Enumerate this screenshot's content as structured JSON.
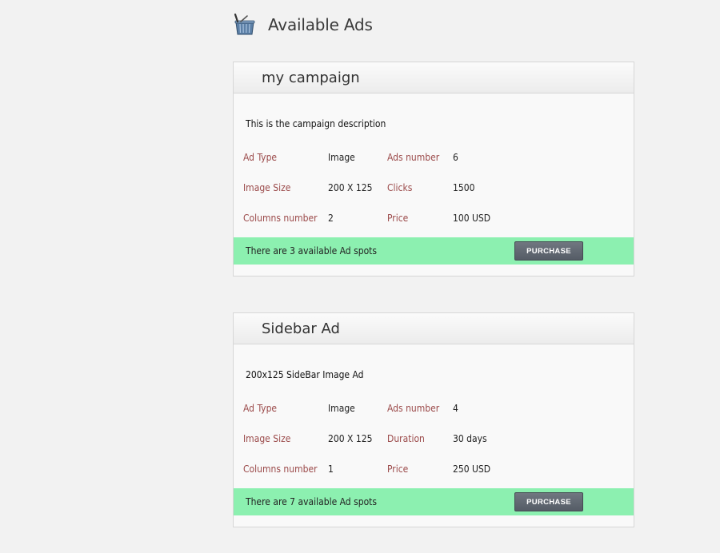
{
  "page": {
    "title": "Available Ads",
    "icon": "basket-icon"
  },
  "colors": {
    "label": "#9b4a4a",
    "footer_bg": "#8cf0b0",
    "button_bg": "#5f6670"
  },
  "campaigns": [
    {
      "title": "my campaign",
      "description": "This is the campaign description",
      "specs": [
        {
          "label": "Ad Type",
          "value": "Image"
        },
        {
          "label": "Ads number",
          "value": "6"
        },
        {
          "label": "Image Size",
          "value": "200 X 125"
        },
        {
          "label": "Clicks",
          "value": "1500"
        },
        {
          "label": "Columns number",
          "value": "2"
        },
        {
          "label": "Price",
          "value": "100 USD"
        }
      ],
      "spots_text": "There are 3 available Ad spots",
      "button_label": "PURCHASE"
    },
    {
      "title": "Sidebar Ad",
      "description": "200x125 SideBar Image Ad",
      "specs": [
        {
          "label": "Ad Type",
          "value": "Image"
        },
        {
          "label": "Ads number",
          "value": "4"
        },
        {
          "label": "Image Size",
          "value": "200 X 125"
        },
        {
          "label": "Duration",
          "value": "30 days"
        },
        {
          "label": "Columns number",
          "value": "1"
        },
        {
          "label": "Price",
          "value": "250 USD"
        }
      ],
      "spots_text": "There are 7 available Ad spots",
      "button_label": "PURCHASE"
    }
  ]
}
